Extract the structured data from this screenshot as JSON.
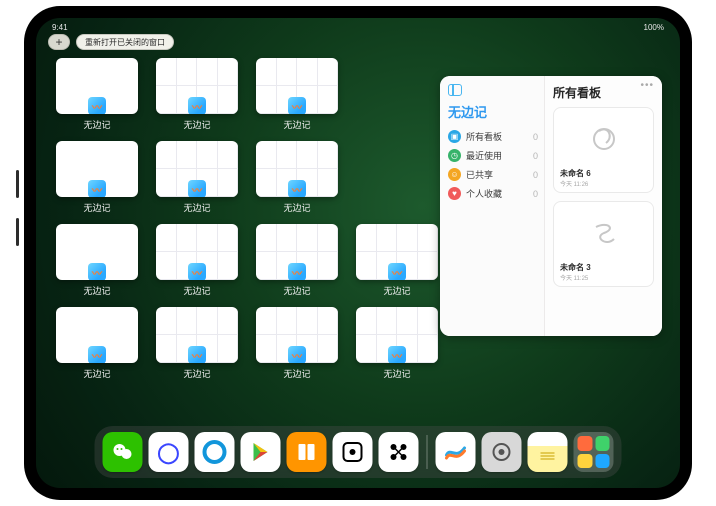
{
  "status": {
    "left_time": "9:41",
    "right": "100%"
  },
  "topbar": {
    "plus": "+",
    "reopen_label": "重新打开已关闭的窗口"
  },
  "app_window_label": "无边记",
  "panel": {
    "sidebar_title": "无边记",
    "right_title": "所有看板",
    "items": [
      {
        "label": "所有看板",
        "count": "0",
        "color": "#2aa7e6"
      },
      {
        "label": "最近使用",
        "count": "0",
        "color": "#36b36a"
      },
      {
        "label": "已共享",
        "count": "0",
        "color": "#f4a623"
      },
      {
        "label": "个人收藏",
        "count": "0",
        "color": "#f05a5a"
      }
    ],
    "boards": [
      {
        "title": "未命名 6",
        "date": "今天 11:26",
        "glyph": "6"
      },
      {
        "title": "未命名 3",
        "date": "今天 11:25",
        "glyph": "3"
      }
    ]
  },
  "dock": {
    "items": [
      {
        "name": "wechat",
        "bg": "#2dc100",
        "glyph": "✱"
      },
      {
        "name": "quark",
        "bg": "#ffffff",
        "glyph_color": "#3a46ff",
        "glyph": "◯"
      },
      {
        "name": "qqbrowser",
        "bg": "#1296db",
        "glyph": "◯"
      },
      {
        "name": "play",
        "bg": "#ffffff",
        "glyph": "▶",
        "glyph_gradient": true
      },
      {
        "name": "books",
        "bg": "#ff9500",
        "glyph": "▮▮"
      },
      {
        "name": "dice",
        "bg": "#ffffff",
        "glyph": "⚀",
        "glyph_color": "#000"
      },
      {
        "name": "connect",
        "bg": "#ffffff",
        "glyph": "⁘",
        "glyph_color": "#000"
      }
    ],
    "right_items": [
      {
        "name": "freeform",
        "bg": "#ffffff",
        "glyph": "〰",
        "glyph_color": "#2aa7e6"
      },
      {
        "name": "settings",
        "bg": "#d8d8d8",
        "glyph": "⚙",
        "glyph_color": "#555"
      },
      {
        "name": "notes",
        "bg": "#fff6bf",
        "glyph": "≣",
        "glyph_color": "#c7a200"
      }
    ]
  }
}
